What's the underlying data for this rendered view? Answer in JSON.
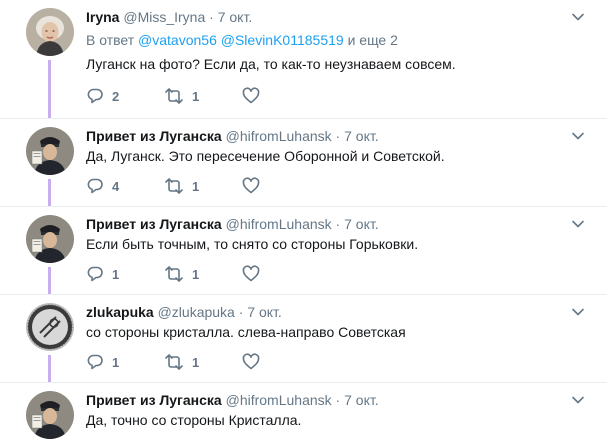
{
  "theme": {
    "accent": "#1da1f2",
    "thread_line": "#c6aef0",
    "muted": "#657786",
    "text": "#14171a",
    "separator": "#e6ecf0"
  },
  "tweets": [
    {
      "fullname": "Iryna",
      "username": "@Miss_Iryna",
      "dot": "·",
      "time": "7 окт.",
      "reply_prefix": "В ответ",
      "reply_mentions": [
        "@vatavon56",
        "@SlevinK01185519"
      ],
      "reply_suffix": "и еще 2",
      "text": "Луганск на фото? Если да, то как-то неузнаваем совсем.",
      "replies": "2",
      "retweets": "1",
      "likes": ""
    },
    {
      "fullname": "Привет из Луганска",
      "username": "@hifromLuhansk",
      "dot": "·",
      "time": "7 окт.",
      "text": "Да, Луганск. Это пересечение Оборонной и Советской.",
      "replies": "4",
      "retweets": "1",
      "likes": ""
    },
    {
      "fullname": "Привет из Луганска",
      "username": "@hifromLuhansk",
      "dot": "·",
      "time": "7 окт.",
      "text": "Если быть точным, то снято со стороны Горьковки.",
      "replies": "1",
      "retweets": "1",
      "likes": ""
    },
    {
      "fullname": "zlukapuka",
      "username": "@zlukapuka",
      "dot": "·",
      "time": "7 окт.",
      "text": "со стороны кристалла. слева-направо Советская",
      "replies": "1",
      "retweets": "1",
      "likes": ""
    },
    {
      "fullname": "Привет из Луганска",
      "username": "@hifromLuhansk",
      "dot": "·",
      "time": "7 окт.",
      "text": "Да, точно со стороны Кристалла."
    }
  ]
}
